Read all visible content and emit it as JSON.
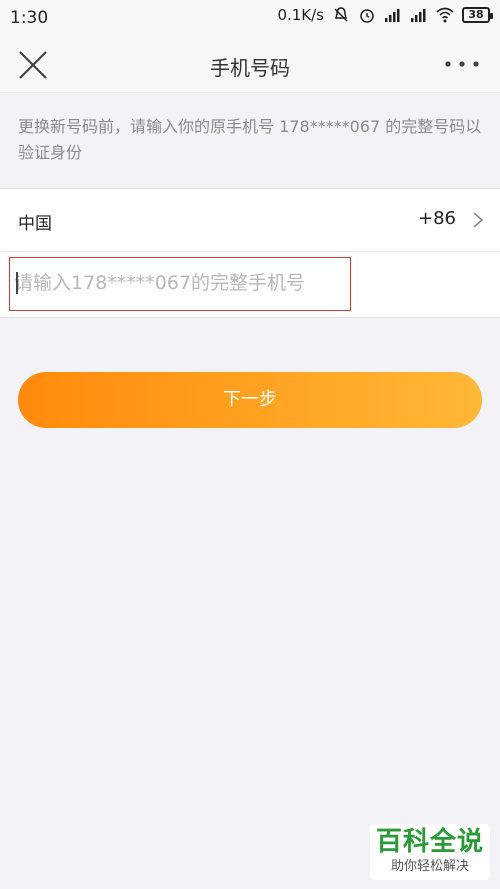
{
  "status_bar": {
    "time": "1:30",
    "network_speed": "0.1K/s",
    "battery": "38",
    "icons": [
      "mute-bell-icon",
      "alarm-icon",
      "signal-icon",
      "hd-signal-icon",
      "wifi-icon",
      "battery-icon"
    ]
  },
  "nav": {
    "title": "手机号码",
    "close_icon": "close-icon",
    "more_icon": "more-icon"
  },
  "hint": "更换新号码前，请输入你的原手机号 178*****067 的完整号码以验证身份",
  "form": {
    "country_name": "中国",
    "country_code": "+86",
    "phone_value": "",
    "phone_placeholder": "请输入178*****067的完整手机号"
  },
  "next_button": "下一步",
  "watermark": {
    "title": "百科全说",
    "subtitle": "助你轻松解决"
  },
  "colors": {
    "accent_start": "#ff8a0d",
    "accent_end": "#ffb836",
    "highlight_border": "#d83a36",
    "watermark_green": "#2a9a37"
  }
}
